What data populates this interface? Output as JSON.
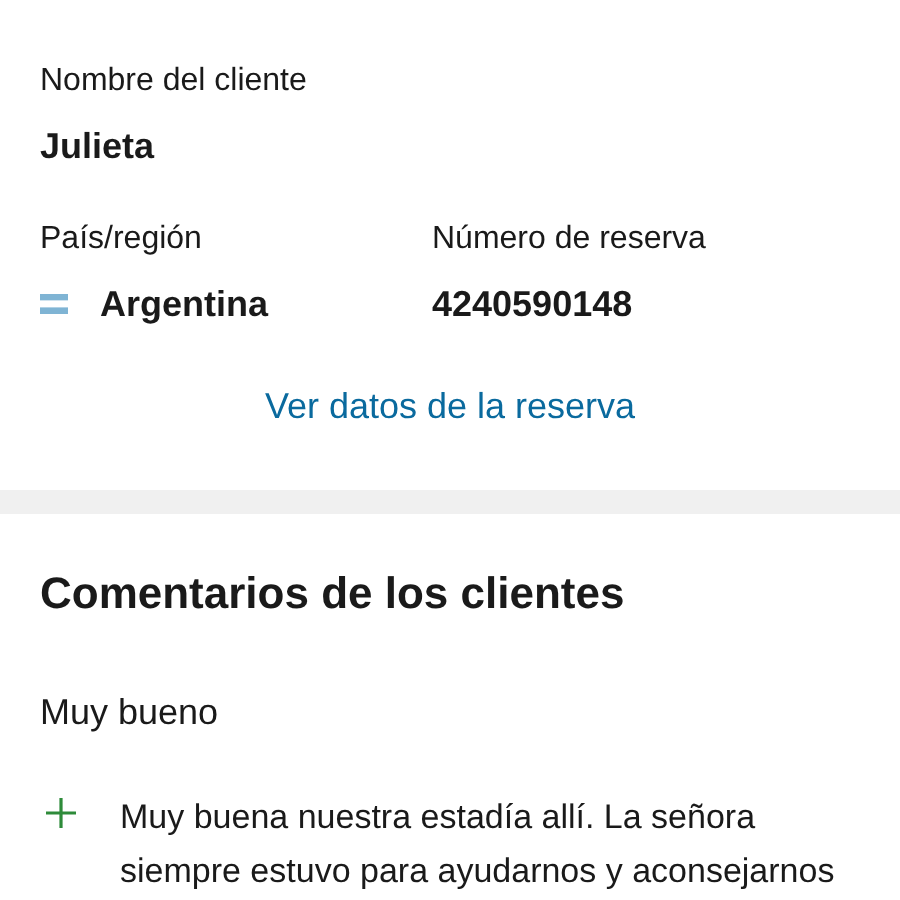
{
  "customer": {
    "label": "Nombre del cliente",
    "name": "Julieta"
  },
  "country": {
    "label": "País/región",
    "value": "Argentina"
  },
  "booking": {
    "label": "Número de reserva",
    "value": "4240590148"
  },
  "link": "Ver datos de la reserva",
  "reviews": {
    "title": "Comentarios de los clientes",
    "rating": "Muy bueno",
    "positive": "Muy buena nuestra estadía allí. La señora siempre estuvo para ayudarnos y aconsejarnos"
  }
}
